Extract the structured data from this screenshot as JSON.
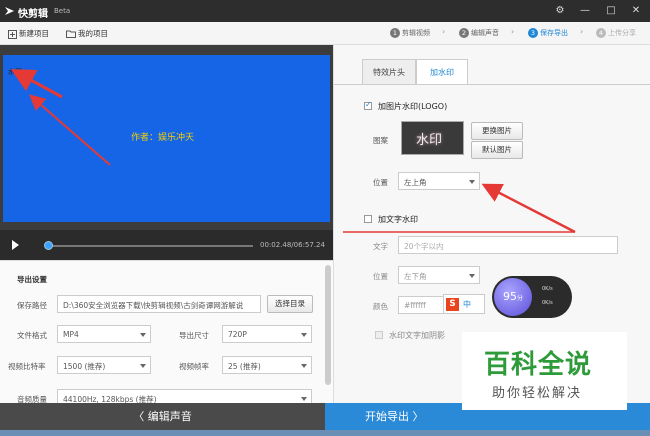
{
  "app": {
    "title": "快剪辑",
    "beta": "Beta"
  },
  "toolbar": {
    "new_project": "新建项目",
    "my_projects": "我的项目"
  },
  "steps": [
    {
      "num": "1",
      "label": "剪辑视频"
    },
    {
      "num": "2",
      "label": "编辑声音"
    },
    {
      "num": "3",
      "label": "保存导出"
    },
    {
      "num": "4",
      "label": "上传分享"
    }
  ],
  "preview": {
    "watermark": "水印",
    "caption": "作者：娱乐冲天",
    "timecode": "00:02.48/06:57.24",
    "progress": 0.01
  },
  "export": {
    "section": "导出设置",
    "path_label": "保存路径",
    "path_value": "D:\\360安全浏览器下载\\快剪辑视频\\古剑奇谭网游解说",
    "choose_dir": "选择目录",
    "format_label": "文件格式",
    "format_value": "MP4",
    "size_label": "导出尺寸",
    "size_value": "720P",
    "bitrate_label": "视频比特率",
    "bitrate_value": "1500 (推荐)",
    "framerate_label": "视频帧率",
    "framerate_value": "25 (推荐)",
    "audio_label": "音频质量",
    "audio_value": "44100Hz, 128kbps (推荐)"
  },
  "right": {
    "tabs": [
      "特效片头",
      "加水印"
    ],
    "image_wm_label": "加图片水印(LOGO)",
    "pattern_label": "图案",
    "pattern_text": "水印",
    "replace_btn": "更换图片",
    "default_btn": "默认图片",
    "position_label": "位置",
    "position_value": "左上角",
    "text_wm_label": "加文字水印",
    "text_label": "文字",
    "text_placeholder": "20个字以内",
    "text_position_label": "位置",
    "text_position_value": "左下角",
    "color_label": "颜色",
    "color_value": "#ffffff",
    "shadow_label": "水印文字加阴影"
  },
  "bottom": {
    "back": "〈 编辑声音",
    "start": "开始导出 〉"
  },
  "overlay": {
    "score": "95",
    "score_unit": "分",
    "rate_up": "0K/s",
    "rate_down": "0K/s",
    "ime_char": "S",
    "ime_mode": "中",
    "baike_title": "百科全说",
    "baike_sub": "助你轻松解决"
  },
  "colors": {
    "accent": "#1e88d6",
    "preview_bg": "#1565e6",
    "caption": "#f5d000",
    "arrow": "#e53935"
  }
}
